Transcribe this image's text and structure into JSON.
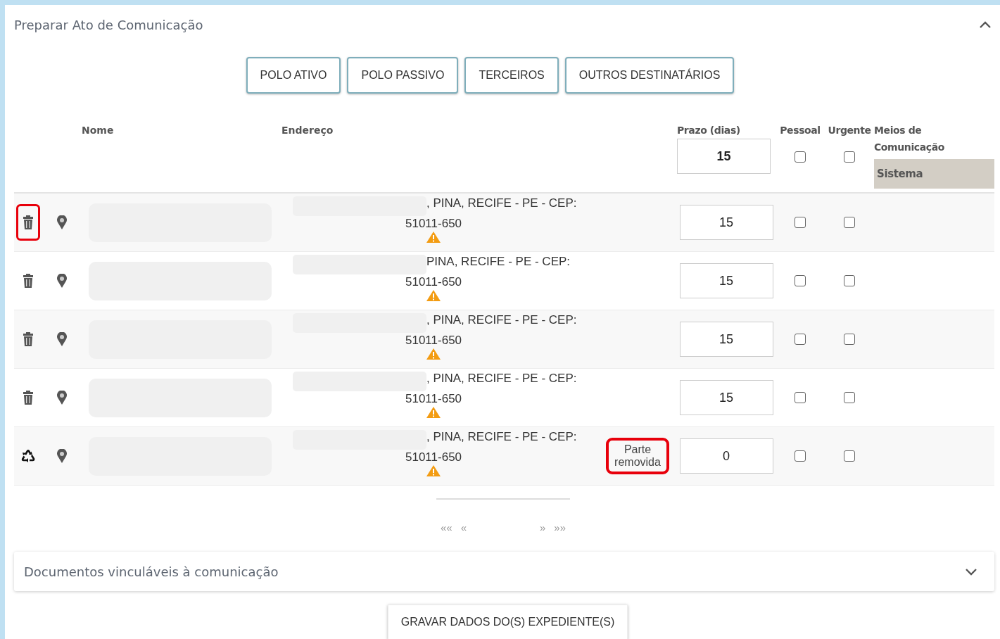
{
  "panel": {
    "title": "Preparar Ato de Comunicação",
    "expanded": true
  },
  "filter_buttons": [
    "POLO ATIVO",
    "POLO PASSIVO",
    "TERCEIROS",
    "OUTROS DESTINATÁRIOS"
  ],
  "table": {
    "columns": [
      "Nome",
      "Endereço",
      "Prazo (dias)",
      "Pessoal",
      "Urgente",
      "Meios de Comunicação"
    ],
    "header_prazo": "15",
    "header_pessoal": false,
    "header_urgente": false,
    "meios_option": "Sistema",
    "rows": [
      {
        "removed": false,
        "highlighted": true,
        "address": ", PINA, RECIFE - PE - CEP:",
        "cep": "51011-650",
        "prazo": "15",
        "pessoal": false,
        "urgente": false
      },
      {
        "removed": false,
        "highlighted": false,
        "address": "PINA, RECIFE - PE - CEP:",
        "cep": "51011-650",
        "prazo": "15",
        "pessoal": false,
        "urgente": false
      },
      {
        "removed": false,
        "highlighted": false,
        "address": ", PINA, RECIFE - PE - CEP:",
        "cep": "51011-650",
        "prazo": "15",
        "pessoal": false,
        "urgente": false
      },
      {
        "removed": false,
        "highlighted": false,
        "address": ", PINA, RECIFE - PE - CEP:",
        "cep": "51011-650",
        "prazo": "15",
        "pessoal": false,
        "urgente": false
      },
      {
        "removed": true,
        "highlighted": false,
        "address": ", PINA, RECIFE - PE - CEP:",
        "cep": "51011-650",
        "status": "Parte removida",
        "status_highlighted": true,
        "prazo": "0",
        "pessoal": false,
        "urgente": false
      }
    ]
  },
  "pagination": [
    "««",
    "«",
    "»",
    "»»"
  ],
  "documents_panel": {
    "title": "Documentos vinculáveis à comunicação",
    "expanded": false
  },
  "save_button": "GRAVAR DADOS DO(S) EXPEDIENTE(S)"
}
